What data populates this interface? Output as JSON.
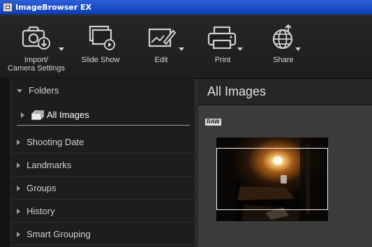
{
  "window": {
    "title": "ImageBrowser EX"
  },
  "toolbar": {
    "import_label": "Import/\nCamera Settings",
    "slideshow_label": "Slide Show",
    "edit_label": "Edit",
    "print_label": "Print",
    "share_label": "Share",
    "icons": [
      "camera-import-icon",
      "slideshow-icon",
      "edit-icon",
      "printer-icon",
      "globe-share-icon"
    ]
  },
  "sidebar": {
    "folders_label": "Folders",
    "all_images_label": "All Images",
    "sections": [
      {
        "label": "Shooting Date"
      },
      {
        "label": "Landmarks"
      },
      {
        "label": "Groups"
      },
      {
        "label": "History"
      },
      {
        "label": "Smart Grouping"
      }
    ]
  },
  "main": {
    "heading": "All Images",
    "raw_badge": "RAW"
  },
  "colors": {
    "titlebar": "#1e4fc8",
    "toolbar_bg": "#232323",
    "sidebar_bg": "#1d1d1d",
    "content_bg": "#3c3c3c",
    "text": "#cfcfcf"
  }
}
